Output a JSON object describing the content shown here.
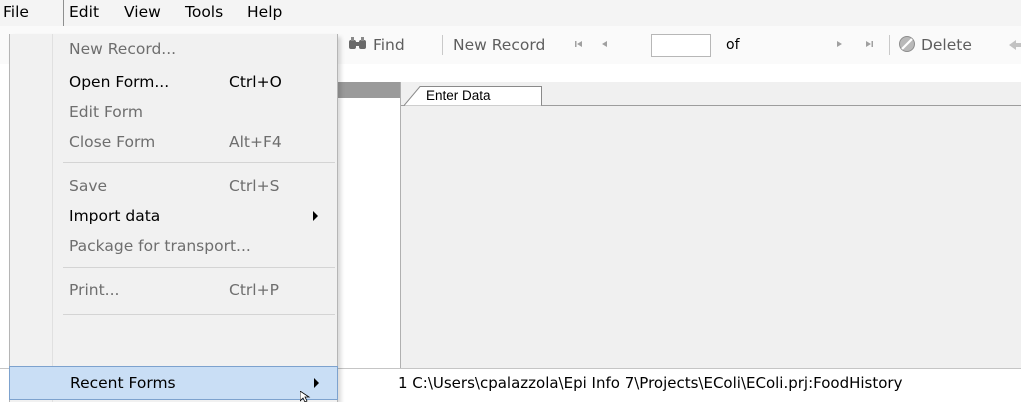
{
  "menubar": {
    "file": "File",
    "edit": "Edit",
    "view": "View",
    "tools": "Tools",
    "help": "Help"
  },
  "toolbar": {
    "find": "Find",
    "new_record": "New Record",
    "record_value": "",
    "of": "of",
    "delete": "Delete"
  },
  "tab": {
    "label": "Enter Data"
  },
  "file_menu": {
    "new_record": "New Record...",
    "open_form": "Open Form...",
    "open_form_shortcut": "Ctrl+O",
    "edit_form": "Edit Form",
    "close_form": "Close Form",
    "close_form_shortcut": "Alt+F4",
    "save": "Save",
    "save_shortcut": "Ctrl+S",
    "import_data": "Import data",
    "package": "Package for transport...",
    "print": "Print...",
    "print_shortcut": "Ctrl+P",
    "recent_forms": "Recent Forms"
  },
  "recent_forms_submenu": {
    "item1": "1 C:\\Users\\cpalazzola\\Epi Info 7\\Projects\\EColi\\EColi.prj:FoodHistory"
  },
  "colors": {
    "highlight": "#c9def5",
    "highlight_border": "#7da2ce",
    "menu_bg": "#f1f1f1",
    "main_bg": "#f0f0f0"
  }
}
